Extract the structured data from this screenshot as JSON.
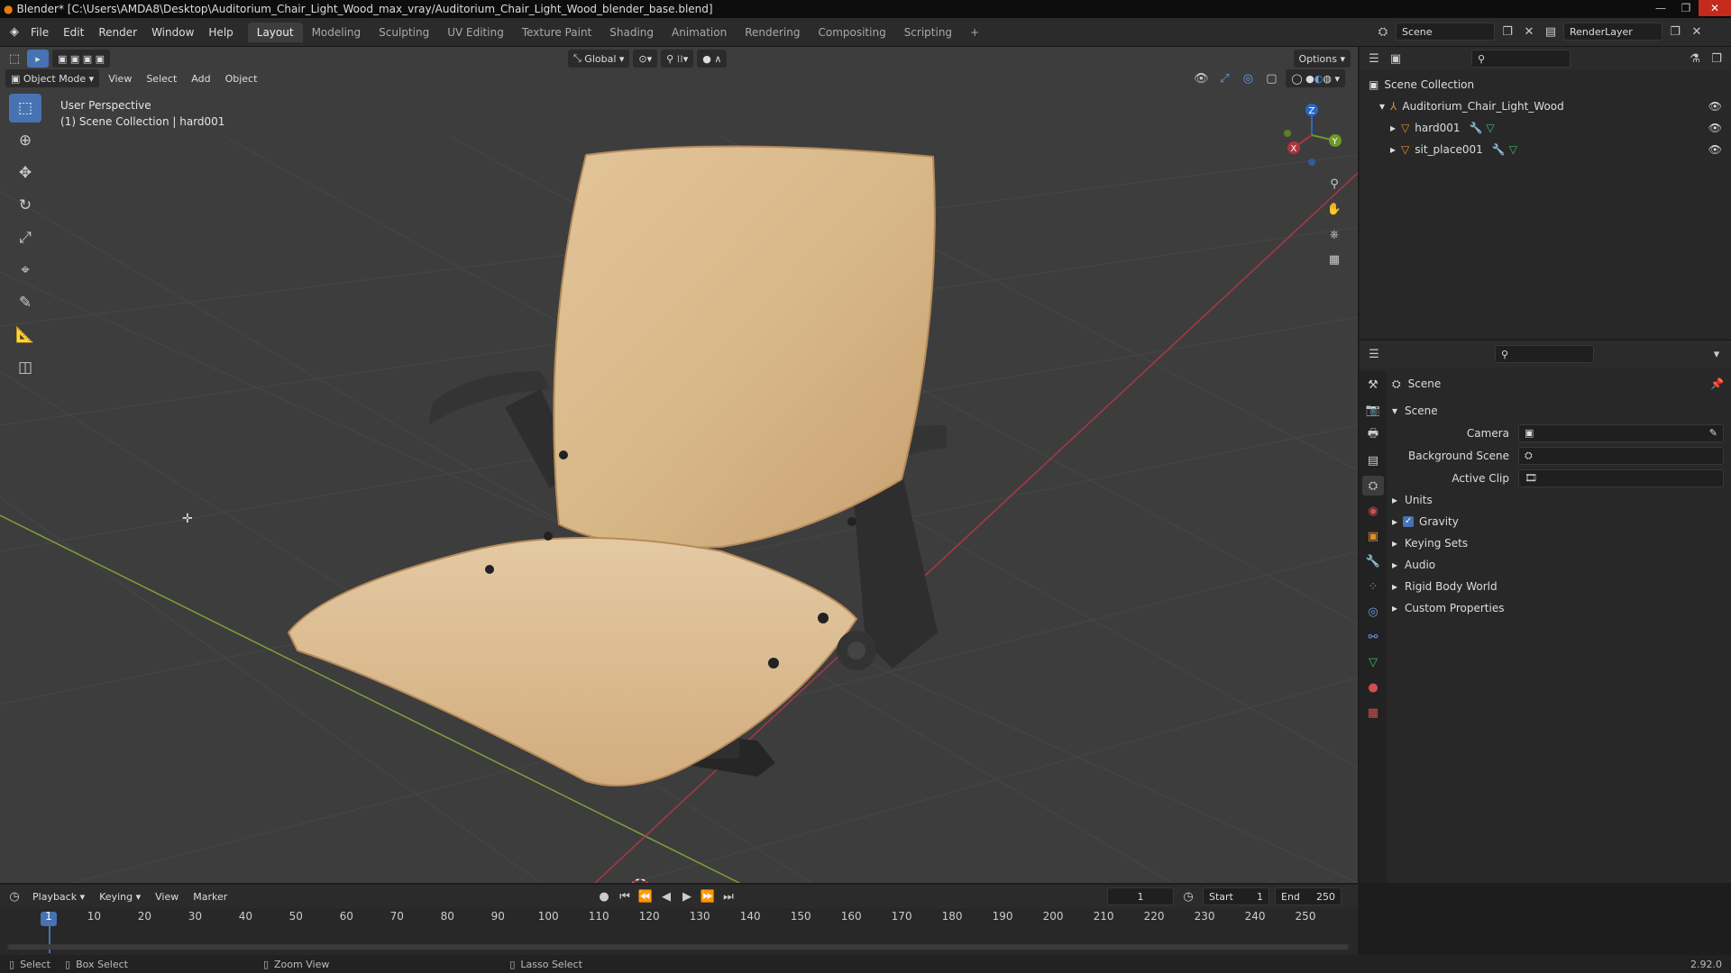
{
  "title_bar": {
    "text": "Blender* [C:\\Users\\AMDA8\\Desktop\\Auditorium_Chair_Light_Wood_max_vray/Auditorium_Chair_Light_Wood_blender_base.blend]"
  },
  "menu": [
    "File",
    "Edit",
    "Render",
    "Window",
    "Help"
  ],
  "workspaces": [
    "Layout",
    "Modeling",
    "Sculpting",
    "UV Editing",
    "Texture Paint",
    "Shading",
    "Animation",
    "Rendering",
    "Compositing",
    "Scripting"
  ],
  "active_workspace": "Layout",
  "scene_field": "Scene",
  "view_layer_field": "RenderLayer",
  "viewport": {
    "transform_orientation": "Global",
    "options_label": "Options",
    "mode": "Object Mode",
    "header_menus": [
      "View",
      "Select",
      "Add",
      "Object"
    ],
    "info_line1": "User Perspective",
    "info_line2": "(1) Scene Collection | hard001",
    "gizmo_axes": {
      "x": "X",
      "y": "Y",
      "z": "Z"
    },
    "colors": {
      "x_axis": "#b0343c",
      "y_axis": "#6c9a22",
      "z_axis": "#2b67c7",
      "wood": "#d9b98a"
    }
  },
  "outliner": {
    "root": "Scene Collection",
    "collection": "Auditorium_Chair_Light_Wood",
    "objects": [
      "hard001",
      "sit_place001"
    ]
  },
  "properties": {
    "header": "Scene",
    "panel": "Scene",
    "fields": [
      {
        "label": "Camera",
        "value": ""
      },
      {
        "label": "Background Scene",
        "value": ""
      },
      {
        "label": "Active Clip",
        "value": ""
      }
    ],
    "sections": [
      "Units",
      "Gravity",
      "Keying Sets",
      "Audio",
      "Rigid Body World",
      "Custom Properties"
    ],
    "gravity_checked": true
  },
  "timeline": {
    "menus": [
      "Playback",
      "Keying",
      "View",
      "Marker"
    ],
    "current_frame": "1",
    "start_label": "Start",
    "start_value": "1",
    "end_label": "End",
    "end_value": "250",
    "ticks": [
      "1",
      "10",
      "20",
      "30",
      "40",
      "50",
      "60",
      "70",
      "80",
      "90",
      "100",
      "110",
      "120",
      "130",
      "140",
      "150",
      "160",
      "170",
      "180",
      "190",
      "200",
      "210",
      "220",
      "230",
      "240",
      "250"
    ]
  },
  "status": {
    "select": "Select",
    "box_select": "Box Select",
    "zoom_view": "Zoom View",
    "lasso_select": "Lasso Select",
    "version": "2.92.0"
  }
}
